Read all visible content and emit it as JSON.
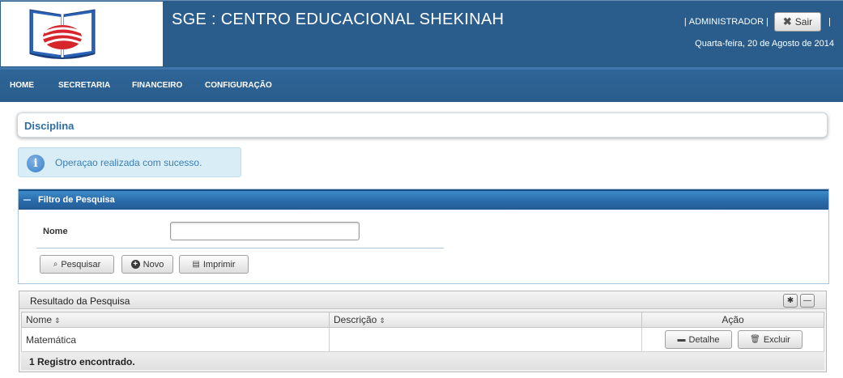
{
  "header": {
    "title": "SGE : CENTRO EDUCACIONAL SHEKINAH",
    "user_label": "ADMINISTRADOR",
    "separator": "|",
    "logout_label": "Sair",
    "date": "Quarta-feira, 20 de Agosto de 2014"
  },
  "nav": {
    "items": [
      {
        "label": "HOME"
      },
      {
        "label": "SECRETARIA"
      },
      {
        "label": "FINANCEIRO"
      },
      {
        "label": "CONFIGURAÇÃO"
      }
    ]
  },
  "page": {
    "title": "Disciplina"
  },
  "message": {
    "icon": "info-icon",
    "text": "Operaçao realizada com sucesso."
  },
  "filter": {
    "title": "Filtro de Pesquisa",
    "nome_label": "Nome",
    "nome_value": "",
    "buttons": {
      "search": "Pesquisar",
      "new": "Novo",
      "print": "Imprimir"
    }
  },
  "results": {
    "title": "Resultado da Pesquisa",
    "columns": [
      "Nome",
      "Descrição",
      "Ação"
    ],
    "rows": [
      {
        "nome": "Matemática",
        "descricao": "",
        "detail_label": "Detalhe",
        "delete_label": "Excluir"
      }
    ],
    "footer": "1 Registro encontrado."
  },
  "colors": {
    "header_bg": "#2a5d8c",
    "accent": "#2e6da4",
    "info_bg": "#d9edf7"
  }
}
